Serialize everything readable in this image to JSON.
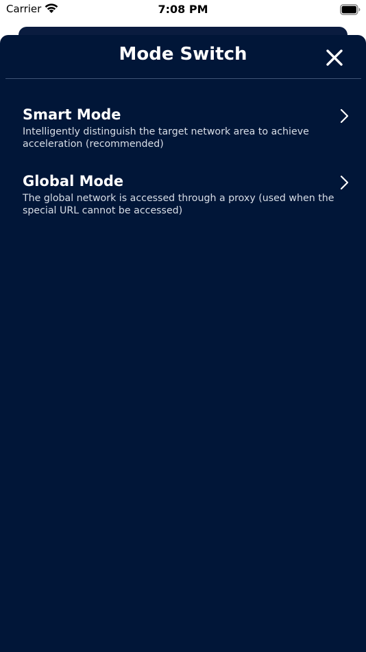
{
  "status_bar": {
    "carrier": "Carrier",
    "time": "7:08 PM"
  },
  "sheet": {
    "title": "Mode Switch",
    "close_icon": "close-icon",
    "background": "#011638"
  },
  "modes": [
    {
      "title": "Smart Mode",
      "description": "Intelligently distinguish the target network area to achieve acceleration (recommended)",
      "icon": "chevron-right-icon"
    },
    {
      "title": "Global Mode",
      "description": "The global network is accessed through a proxy (used when the special URL cannot be accessed)",
      "icon": "chevron-right-icon"
    }
  ]
}
